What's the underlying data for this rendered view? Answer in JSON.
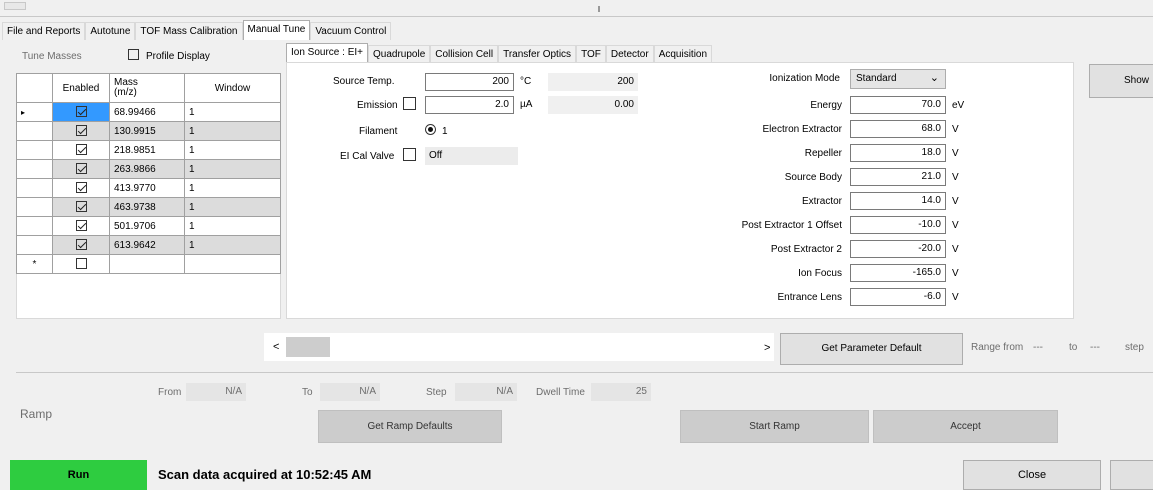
{
  "main_tabs": [
    "File and Reports",
    "Autotune",
    "TOF Mass Calibration",
    "Manual Tune",
    "Vacuum Control"
  ],
  "tune_masses": {
    "title": "Tune Masses",
    "profile_display": "Profile Display",
    "headers": [
      "Enabled",
      "Mass\n(m/z)",
      "Window"
    ],
    "rows": [
      {
        "mass": "68.99466",
        "window": "1"
      },
      {
        "mass": "130.9915",
        "window": "1"
      },
      {
        "mass": "218.9851",
        "window": "1"
      },
      {
        "mass": "263.9866",
        "window": "1"
      },
      {
        "mass": "413.9770",
        "window": "1"
      },
      {
        "mass": "463.9738",
        "window": "1"
      },
      {
        "mass": "501.9706",
        "window": "1"
      },
      {
        "mass": "613.9642",
        "window": "1"
      }
    ],
    "row_pointer": "▸",
    "new_row_marker": "*"
  },
  "sub_tabs": [
    "Ion Source : EI+",
    "Quadrupole",
    "Collision Cell",
    "Transfer Optics",
    "TOF",
    "Detector",
    "Acquisition"
  ],
  "ion_source": {
    "source_temp_label": "Source Temp.",
    "source_temp_value": "200",
    "source_temp_unit": "°C",
    "source_temp_readback": "200",
    "emission_label": "Emission",
    "emission_value": "2.0",
    "emission_unit": "µA",
    "emission_readback": "0.00",
    "filament_label": "Filament",
    "filament_value": "1",
    "ei_cal_label": "EI Cal Valve",
    "ei_cal_state": "Off"
  },
  "params": {
    "ionization_mode_label": "Ionization Mode",
    "ionization_mode_value": "Standard",
    "items": [
      {
        "label": "Energy",
        "value": "70.0",
        "unit": "eV"
      },
      {
        "label": "Electron Extractor",
        "value": "68.0",
        "unit": "V"
      },
      {
        "label": "Repeller",
        "value": "18.0",
        "unit": "V"
      },
      {
        "label": "Source Body",
        "value": "21.0",
        "unit": "V"
      },
      {
        "label": "Extractor",
        "value": "14.0",
        "unit": "V"
      },
      {
        "label": "Post Extractor 1 Offset",
        "value": "-10.0",
        "unit": "V"
      },
      {
        "label": "Post Extractor 2",
        "value": "-20.0",
        "unit": "V"
      },
      {
        "label": "Ion Focus",
        "value": "-165.0",
        "unit": "V"
      },
      {
        "label": "Entrance Lens",
        "value": "-6.0",
        "unit": "V"
      }
    ],
    "show_button": "Show"
  },
  "scroll": {
    "left_arrow": "<",
    "right_arrow": ">"
  },
  "get_param_default": "Get Parameter Default",
  "range": {
    "from_label": "Range from",
    "from_value": "---",
    "to_label": "to",
    "to_value": "---",
    "step_label": "step"
  },
  "ramp": {
    "title": "Ramp",
    "from_label": "From",
    "from_value": "N/A",
    "to_label": "To",
    "to_value": "N/A",
    "step_label": "Step",
    "step_value": "N/A",
    "dwell_label": "Dwell Time",
    "dwell_value": "25",
    "get_defaults": "Get Ramp Defaults",
    "start": "Start Ramp",
    "accept": "Accept"
  },
  "footer": {
    "run": "Run",
    "status": "Scan data acquired at 10:52:45 AM",
    "close": "Close"
  },
  "colors": {
    "run_green": "#2ecc40",
    "selection_blue": "#3399ff"
  }
}
